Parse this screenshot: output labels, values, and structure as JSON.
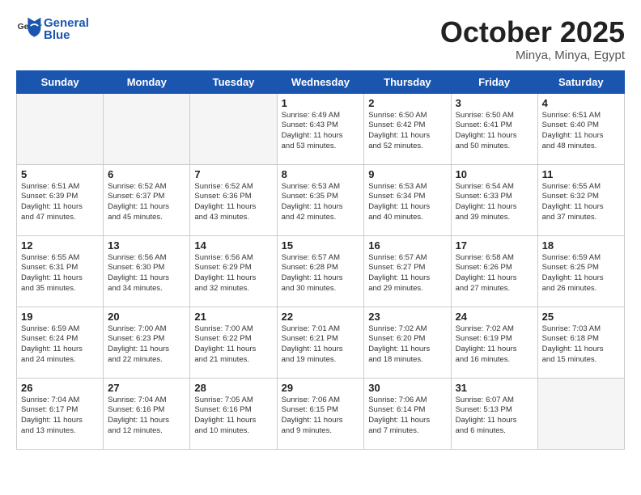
{
  "header": {
    "logo_general": "General",
    "logo_blue": "Blue",
    "month_title": "October 2025",
    "location": "Minya, Minya, Egypt"
  },
  "days_of_week": [
    "Sunday",
    "Monday",
    "Tuesday",
    "Wednesday",
    "Thursday",
    "Friday",
    "Saturday"
  ],
  "weeks": [
    [
      {
        "day": "",
        "info": ""
      },
      {
        "day": "",
        "info": ""
      },
      {
        "day": "",
        "info": ""
      },
      {
        "day": "1",
        "info": "Sunrise: 6:49 AM\nSunset: 6:43 PM\nDaylight: 11 hours\nand 53 minutes."
      },
      {
        "day": "2",
        "info": "Sunrise: 6:50 AM\nSunset: 6:42 PM\nDaylight: 11 hours\nand 52 minutes."
      },
      {
        "day": "3",
        "info": "Sunrise: 6:50 AM\nSunset: 6:41 PM\nDaylight: 11 hours\nand 50 minutes."
      },
      {
        "day": "4",
        "info": "Sunrise: 6:51 AM\nSunset: 6:40 PM\nDaylight: 11 hours\nand 48 minutes."
      }
    ],
    [
      {
        "day": "5",
        "info": "Sunrise: 6:51 AM\nSunset: 6:39 PM\nDaylight: 11 hours\nand 47 minutes."
      },
      {
        "day": "6",
        "info": "Sunrise: 6:52 AM\nSunset: 6:37 PM\nDaylight: 11 hours\nand 45 minutes."
      },
      {
        "day": "7",
        "info": "Sunrise: 6:52 AM\nSunset: 6:36 PM\nDaylight: 11 hours\nand 43 minutes."
      },
      {
        "day": "8",
        "info": "Sunrise: 6:53 AM\nSunset: 6:35 PM\nDaylight: 11 hours\nand 42 minutes."
      },
      {
        "day": "9",
        "info": "Sunrise: 6:53 AM\nSunset: 6:34 PM\nDaylight: 11 hours\nand 40 minutes."
      },
      {
        "day": "10",
        "info": "Sunrise: 6:54 AM\nSunset: 6:33 PM\nDaylight: 11 hours\nand 39 minutes."
      },
      {
        "day": "11",
        "info": "Sunrise: 6:55 AM\nSunset: 6:32 PM\nDaylight: 11 hours\nand 37 minutes."
      }
    ],
    [
      {
        "day": "12",
        "info": "Sunrise: 6:55 AM\nSunset: 6:31 PM\nDaylight: 11 hours\nand 35 minutes."
      },
      {
        "day": "13",
        "info": "Sunrise: 6:56 AM\nSunset: 6:30 PM\nDaylight: 11 hours\nand 34 minutes."
      },
      {
        "day": "14",
        "info": "Sunrise: 6:56 AM\nSunset: 6:29 PM\nDaylight: 11 hours\nand 32 minutes."
      },
      {
        "day": "15",
        "info": "Sunrise: 6:57 AM\nSunset: 6:28 PM\nDaylight: 11 hours\nand 30 minutes."
      },
      {
        "day": "16",
        "info": "Sunrise: 6:57 AM\nSunset: 6:27 PM\nDaylight: 11 hours\nand 29 minutes."
      },
      {
        "day": "17",
        "info": "Sunrise: 6:58 AM\nSunset: 6:26 PM\nDaylight: 11 hours\nand 27 minutes."
      },
      {
        "day": "18",
        "info": "Sunrise: 6:59 AM\nSunset: 6:25 PM\nDaylight: 11 hours\nand 26 minutes."
      }
    ],
    [
      {
        "day": "19",
        "info": "Sunrise: 6:59 AM\nSunset: 6:24 PM\nDaylight: 11 hours\nand 24 minutes."
      },
      {
        "day": "20",
        "info": "Sunrise: 7:00 AM\nSunset: 6:23 PM\nDaylight: 11 hours\nand 22 minutes."
      },
      {
        "day": "21",
        "info": "Sunrise: 7:00 AM\nSunset: 6:22 PM\nDaylight: 11 hours\nand 21 minutes."
      },
      {
        "day": "22",
        "info": "Sunrise: 7:01 AM\nSunset: 6:21 PM\nDaylight: 11 hours\nand 19 minutes."
      },
      {
        "day": "23",
        "info": "Sunrise: 7:02 AM\nSunset: 6:20 PM\nDaylight: 11 hours\nand 18 minutes."
      },
      {
        "day": "24",
        "info": "Sunrise: 7:02 AM\nSunset: 6:19 PM\nDaylight: 11 hours\nand 16 minutes."
      },
      {
        "day": "25",
        "info": "Sunrise: 7:03 AM\nSunset: 6:18 PM\nDaylight: 11 hours\nand 15 minutes."
      }
    ],
    [
      {
        "day": "26",
        "info": "Sunrise: 7:04 AM\nSunset: 6:17 PM\nDaylight: 11 hours\nand 13 minutes."
      },
      {
        "day": "27",
        "info": "Sunrise: 7:04 AM\nSunset: 6:16 PM\nDaylight: 11 hours\nand 12 minutes."
      },
      {
        "day": "28",
        "info": "Sunrise: 7:05 AM\nSunset: 6:16 PM\nDaylight: 11 hours\nand 10 minutes."
      },
      {
        "day": "29",
        "info": "Sunrise: 7:06 AM\nSunset: 6:15 PM\nDaylight: 11 hours\nand 9 minutes."
      },
      {
        "day": "30",
        "info": "Sunrise: 7:06 AM\nSunset: 6:14 PM\nDaylight: 11 hours\nand 7 minutes."
      },
      {
        "day": "31",
        "info": "Sunrise: 6:07 AM\nSunset: 5:13 PM\nDaylight: 11 hours\nand 6 minutes."
      },
      {
        "day": "",
        "info": ""
      }
    ]
  ]
}
